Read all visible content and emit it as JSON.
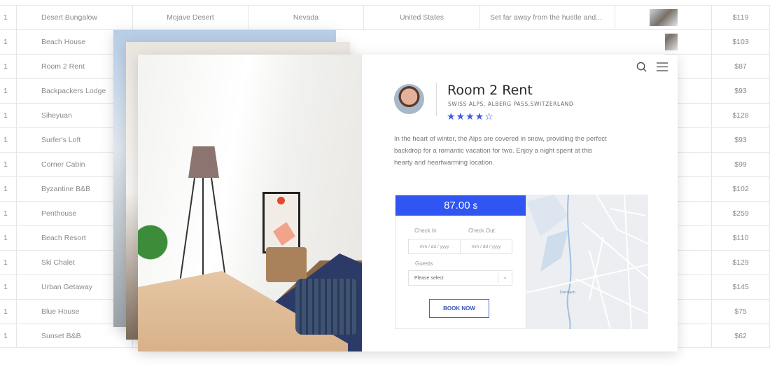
{
  "table": {
    "rows": [
      {
        "n": "1",
        "name": "Desert Bungalow",
        "region": "Mojave Desert",
        "state": "Nevada",
        "country": "United States",
        "desc": "Set far away from the hustle and...",
        "price": "$119"
      },
      {
        "n": "1",
        "name": "Beach House",
        "price": "$103"
      },
      {
        "n": "1",
        "name": "Room 2 Rent",
        "price": "$87"
      },
      {
        "n": "1",
        "name": "Backpackers Lodge",
        "price": "$93"
      },
      {
        "n": "1",
        "name": "Siheyuan",
        "price": "$128"
      },
      {
        "n": "1",
        "name": "Surfer's Loft",
        "price": "$93"
      },
      {
        "n": "1",
        "name": "Corner Cabin",
        "price": "$99"
      },
      {
        "n": "1",
        "name": "Byzantine B&B",
        "price": "$102"
      },
      {
        "n": "1",
        "name": "Penthouse",
        "price": "$259"
      },
      {
        "n": "1",
        "name": "Beach Resort",
        "price": "$110"
      },
      {
        "n": "1",
        "name": "Ski Chalet",
        "price": "$129"
      },
      {
        "n": "1",
        "name": "Urban Getaway",
        "price": "$145"
      },
      {
        "n": "1",
        "name": "Blue House",
        "price": "$75"
      },
      {
        "n": "1",
        "name": "Sunset B&B",
        "price": "$62"
      }
    ]
  },
  "card": {
    "title": "Room 2 Rent",
    "location": "SWISS ALPS, ALBERG PASS,SWITZERLAND",
    "rating": 4,
    "rating_max": 5,
    "stars": "★★★★☆",
    "description": "In the heart of winter, the Alps are covered in snow, providing the perfect backdrop for a romantic vacation for two. Enjoy a night spent at this hearty and heartwarming location.",
    "price": "87.00",
    "currency": "$",
    "check_in_label": "Check In",
    "check_out_label": "Check Out",
    "date_placeholder": "mm / dd / yyyy",
    "guests_label": "Guests",
    "guests_value": "Please select",
    "book_label": "BOOK NOW",
    "map_label": "Dornbach",
    "accent": "#2f55f2"
  }
}
